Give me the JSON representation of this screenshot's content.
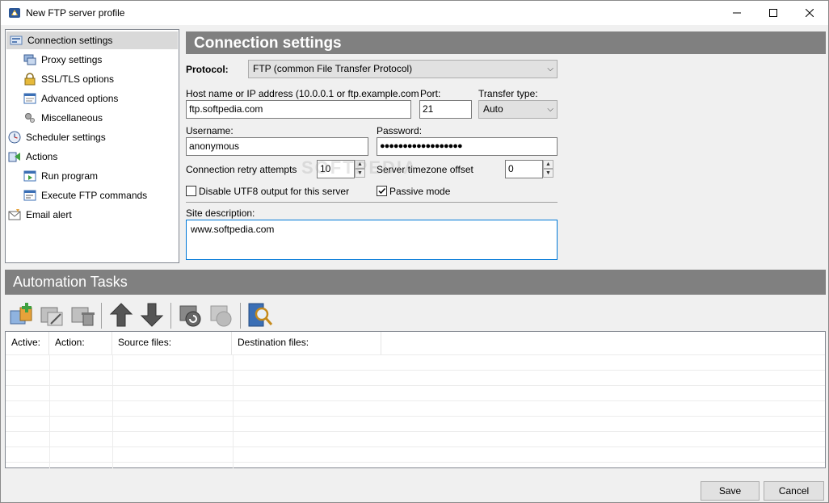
{
  "window": {
    "title": "New FTP server profile",
    "controls": {
      "minimize": "—",
      "maximize": "☐",
      "close": "✕"
    }
  },
  "sidebar": {
    "items": [
      {
        "label": "Connection settings",
        "icon": "connection-icon",
        "selected": true
      },
      {
        "label": "Proxy settings",
        "icon": "proxy-icon"
      },
      {
        "label": "SSL/TLS options",
        "icon": "lock-icon"
      },
      {
        "label": "Advanced options",
        "icon": "advanced-icon"
      },
      {
        "label": "Miscellaneous",
        "icon": "misc-icon"
      },
      {
        "label": "Scheduler settings",
        "icon": "clock-icon"
      },
      {
        "label": "Actions",
        "icon": "actions-icon"
      },
      {
        "label": "Run program",
        "icon": "run-icon"
      },
      {
        "label": "Execute FTP commands",
        "icon": "ftp-commands-icon"
      },
      {
        "label": "Email alert",
        "icon": "email-icon"
      }
    ]
  },
  "connection": {
    "header": "Connection settings",
    "protocol_label": "Protocol:",
    "protocol_value": "FTP (common File Transfer Protocol)",
    "host_label": "Host name or IP address (10.0.0.1 or ftp.example.com",
    "host_value": "ftp.softpedia.com",
    "port_label": "Port:",
    "port_value": "21",
    "transfer_label": "Transfer type:",
    "transfer_value": "Auto",
    "username_label": "Username:",
    "username_value": "anonymous",
    "password_label": "Password:",
    "password_value": "●●●●●●●●●●●●●●●●●●",
    "retry_label": "Connection retry attempts",
    "retry_value": "10",
    "timezone_label": "Server timezone offset",
    "timezone_value": "0",
    "utf8_label": "Disable UTF8 output for this server",
    "utf8_checked": false,
    "passive_label": "Passive mode",
    "passive_checked": true,
    "site_desc_label": "Site description:",
    "site_desc_value": "www.softpedia.com"
  },
  "automation": {
    "header": "Automation Tasks",
    "toolbar": [
      "add-task-icon",
      "edit-task-icon",
      "delete-task-icon",
      "move-up-icon",
      "move-down-icon",
      "run-task-icon",
      "run-all-icon",
      "search-task-icon"
    ],
    "columns": [
      "Active:",
      "Action:",
      "Source files:",
      "Destination files:"
    ]
  },
  "buttons": {
    "save": "Save",
    "cancel": "Cancel"
  },
  "watermark": "SOFTPEDIA"
}
